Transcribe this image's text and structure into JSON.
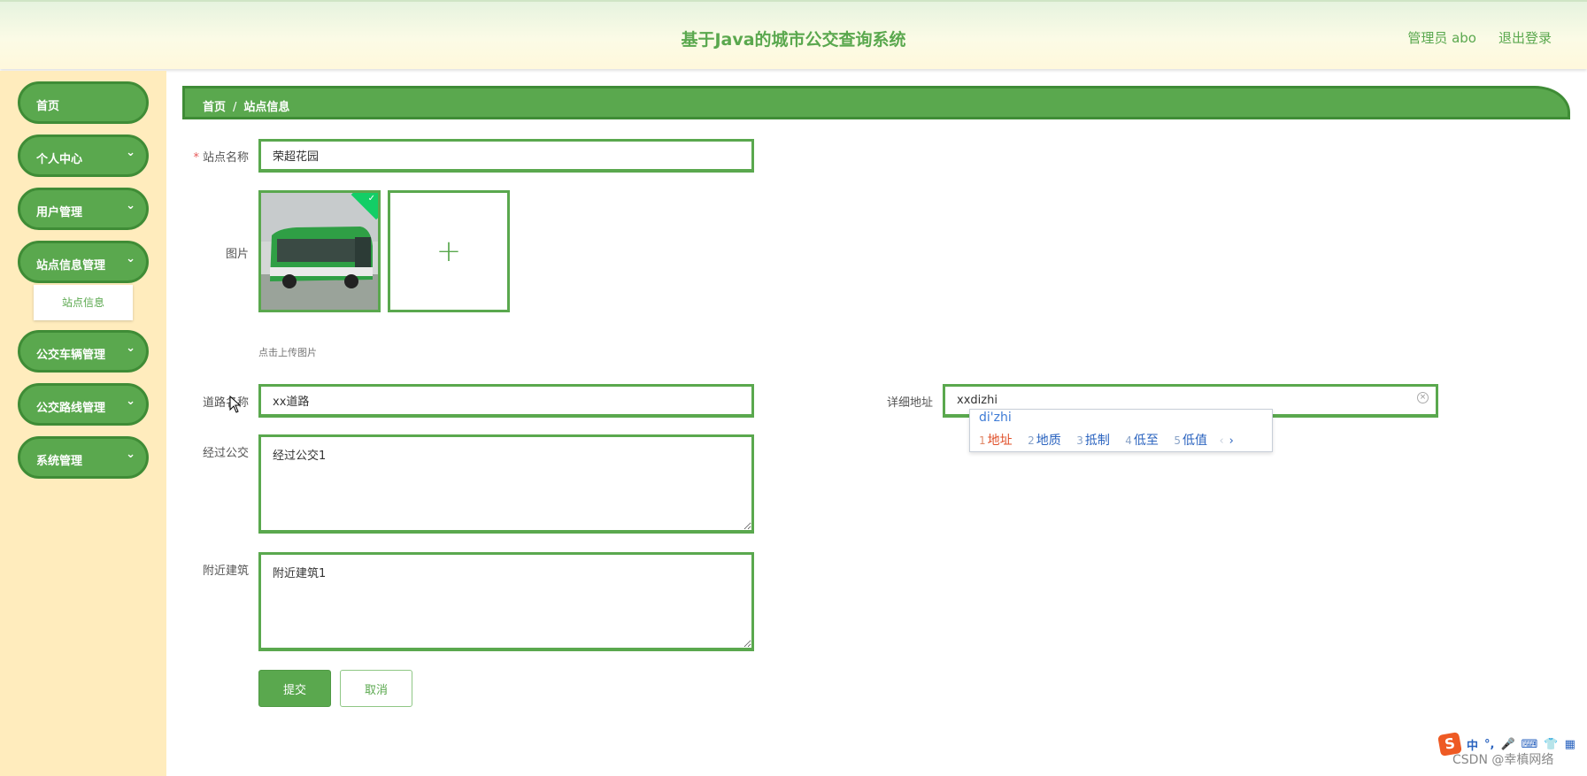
{
  "header": {
    "title": "基于Java的城市公交查询系统",
    "user": "管理员 abo",
    "logout": "退出登录"
  },
  "sidebar": {
    "items": [
      {
        "label": "首页",
        "chevron": ""
      },
      {
        "label": "个人中心",
        "chevron": "⌄"
      },
      {
        "label": "用户管理",
        "chevron": "⌄"
      },
      {
        "label": "站点信息管理",
        "chevron": "⌄"
      },
      {
        "label": "公交车辆管理",
        "chevron": "⌄"
      },
      {
        "label": "公交路线管理",
        "chevron": "⌄"
      },
      {
        "label": "系统管理",
        "chevron": "⌄"
      }
    ],
    "submenu": "站点信息"
  },
  "breadcrumb": {
    "home": "首页",
    "sep": "/",
    "current": "站点信息"
  },
  "form": {
    "name": {
      "required": "*",
      "label": "站点名称",
      "value": "荣超花园"
    },
    "image": {
      "label": "图片",
      "tip": "点击上传图片",
      "check": "✓",
      "plus": "+"
    },
    "road": {
      "label": "道路名称",
      "value": "xx道路"
    },
    "address": {
      "label": "详细地址",
      "value": "xxdizhi",
      "clear": "×"
    },
    "bus": {
      "label": "经过公交",
      "value": "经过公交1"
    },
    "building": {
      "label": "附近建筑",
      "value": "附近建筑1"
    },
    "submit": "提交",
    "cancel": "取消"
  },
  "ime": {
    "pinyin": "di'zhi",
    "candidates": [
      {
        "n": "1",
        "text": "地址"
      },
      {
        "n": "2",
        "text": "地质"
      },
      {
        "n": "3",
        "text": "抵制"
      },
      {
        "n": "4",
        "text": "低至"
      },
      {
        "n": "5",
        "text": "低值"
      }
    ],
    "prev": "‹",
    "next": "›"
  },
  "ime_toolbar": {
    "logo": "S",
    "lang": "中",
    "punct": "°,",
    "mic": "🎤",
    "keyboard": "⌨",
    "skin": "👕",
    "apps": "▦"
  },
  "watermark": "CSDN @幸槙网络",
  "colors": {
    "primary": "#5aa84e",
    "primary_dark": "#3f8c36",
    "sidebar_bg": "#ffecbd",
    "success": "#13ce66"
  }
}
